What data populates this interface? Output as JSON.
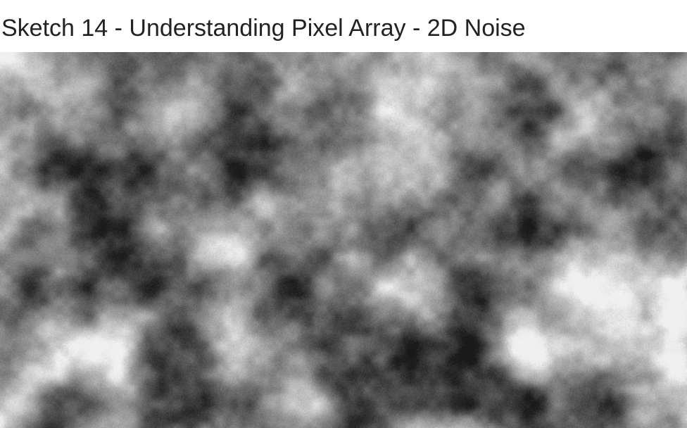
{
  "page": {
    "title": "Sketch 14 - Understanding Pixel Array - 2D Noise"
  },
  "sketch": {
    "kind": "2D Perlin noise grayscale canvas",
    "background": "#ffffff",
    "text_color": "#222222"
  }
}
